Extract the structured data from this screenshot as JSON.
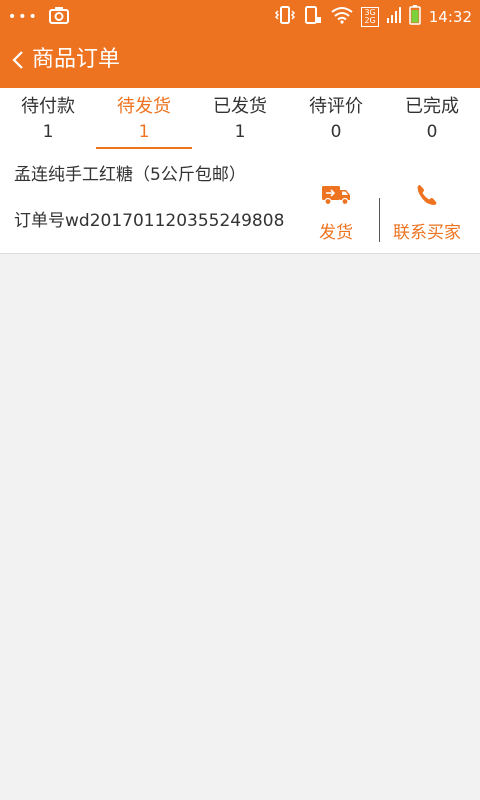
{
  "status_bar": {
    "dots": "•••",
    "net_top": "3G",
    "net_bottom": "2G",
    "time": "14:32"
  },
  "header": {
    "title": "商品订单",
    "back_icon": "chevron-left-icon"
  },
  "tabs": [
    {
      "label": "待付款",
      "count": "1",
      "active": false
    },
    {
      "label": "待发货",
      "count": "1",
      "active": true
    },
    {
      "label": "已发货",
      "count": "1",
      "active": false
    },
    {
      "label": "待评价",
      "count": "0",
      "active": false
    },
    {
      "label": "已完成",
      "count": "0",
      "active": false
    }
  ],
  "order": {
    "product_name": "孟连纯手工红糖（5公斤包邮）",
    "order_number": "订单号wd20170112035524980​8",
    "actions": {
      "ship": {
        "label": "发货",
        "icon": "truck-icon"
      },
      "contact": {
        "label": "联系买家",
        "icon": "phone-icon"
      }
    }
  },
  "colors": {
    "accent": "#ee7320",
    "background": "#f2f2f2"
  }
}
